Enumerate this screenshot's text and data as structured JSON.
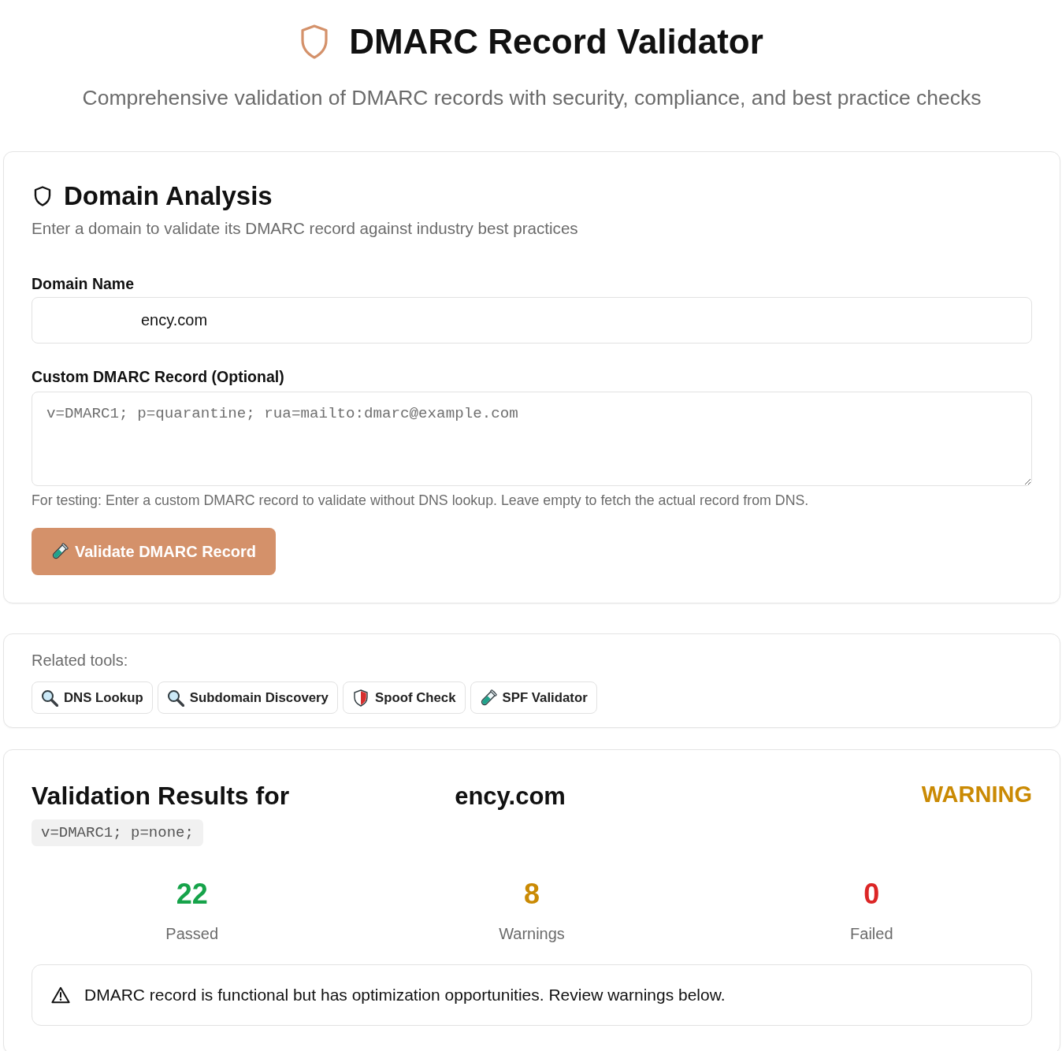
{
  "header": {
    "title": "DMARC Record Validator",
    "subtitle": "Comprehensive validation of DMARC records with security, compliance, and best practice checks"
  },
  "analysis": {
    "title": "Domain Analysis",
    "description": "Enter a domain to validate its DMARC record against industry best practices",
    "domain_field": {
      "label": "Domain Name",
      "value": "ency.com"
    },
    "record_field": {
      "label": "Custom DMARC Record (Optional)",
      "placeholder": "v=DMARC1; p=quarantine; rua=mailto:dmarc@example.com",
      "hint": "For testing: Enter a custom DMARC record to validate without DNS lookup. Leave empty to fetch the actual record from DNS."
    },
    "submit_button": "Validate DMARC Record"
  },
  "related_tools": {
    "label": "Related tools:",
    "tools": [
      {
        "label": "DNS Lookup",
        "kind": "search"
      },
      {
        "label": "Subdomain Discovery",
        "kind": "search"
      },
      {
        "label": "Spoof Check",
        "kind": "shield"
      },
      {
        "label": "SPF Validator",
        "kind": "tube"
      }
    ]
  },
  "results": {
    "title": "Validation Results for",
    "domain": "ency.com",
    "status": {
      "label": "WARNING",
      "kind": "warning"
    },
    "record": "v=DMARC1; p=none;",
    "stats": [
      {
        "value": "22",
        "label": "Passed",
        "color": "#16a34a"
      },
      {
        "value": "8",
        "label": "Warnings",
        "color": "#ca8a04"
      },
      {
        "value": "0",
        "label": "Failed",
        "color": "#dc2626"
      }
    ],
    "alert": "DMARC record is functional but has optimization opportunities. Review warnings below."
  }
}
